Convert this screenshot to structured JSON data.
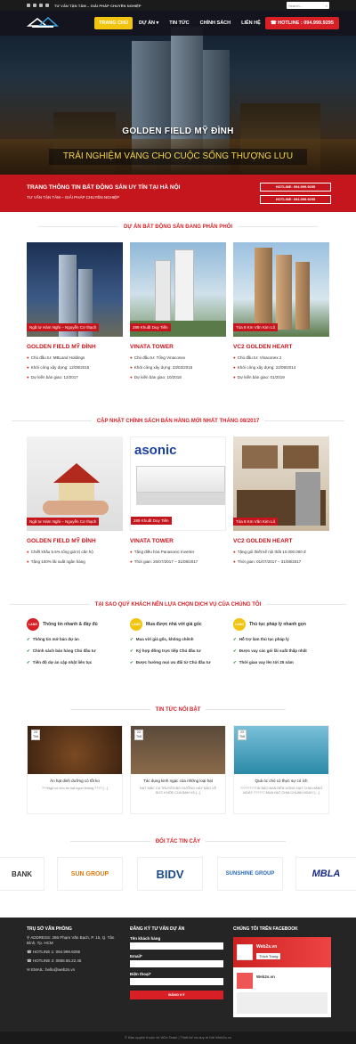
{
  "topbar": {
    "tagline": "TƯ VẤN TẬN TÂM – GIẢI PHÁP CHUYÊN NGHIỆP",
    "search_placeholder": "Search..."
  },
  "nav": {
    "items": [
      "TRANG CHỦ",
      "DỰ ÁN ▾",
      "TIN TỨC",
      "CHÍNH SÁCH",
      "LIÊN HỆ"
    ],
    "hotline": "☎ HOTLINE : 094.999.9295"
  },
  "hero": {
    "title": "GOLDEN FIELD MỸ ĐÌNH",
    "subtitle": "TRẢI NGHIỆM VÀNG CHO CUỘC SỐNG THƯỢNG LƯU"
  },
  "banner": {
    "heading": "TRANG THÔNG TIN BẤT ĐỘNG SẢN UY TÍN TẠI HÀ NỘI",
    "sub": "TƯ VẤN TẬN TÂM – GIẢI PHÁP CHUYÊN NGHIỆP",
    "hotline1": "HOTLINE: 094.999.9295",
    "hotline2": "HOTLINE: 094.999.9295"
  },
  "projects": {
    "title": "DỰ ÁN BẤT ĐỘNG SẢN ĐANG PHÂN PHỐI",
    "cards": [
      {
        "label": "Ngã tư Hàm Nghi – Nguyễn Cơ thạch",
        "name": "GOLDEN FIELD MỸ ĐÌNH",
        "b1": "Chủ đầu tư: MBLand Holdings",
        "b2": "Khởi công xây dựng: 12/08/2015",
        "b3": "Dự kiến bàn giao: 12/2017"
      },
      {
        "label": "289 Khuất Duy Tiến",
        "name": "VINATA TOWER",
        "b1": "Chủ đầu tư: Tổng Vinaconex",
        "b2": "Khởi công xây dựng: 23/03/2015",
        "b3": "Dự kiến bàn giao: 10/2018"
      },
      {
        "label": "Tòa 8 Km Văn Kim Lũ",
        "name": "VC2 GOLDEN HEART",
        "b1": "Chủ đầu tư: Vinaconex 2",
        "b2": "Khởi công xây dựng: 22/09/2014",
        "b3": "Dự kiến bàn giao: 01/2019"
      }
    ]
  },
  "policy": {
    "title": "CẬP NHẬT CHÍNH SÁCH BÁN HÀNG MỚI NHẤT THÁNG 08/2017",
    "cards": [
      {
        "label": "Ngã tư Hàm Nghi – Nguyễn Cơ thạch",
        "name": "GOLDEN FIELD MỸ ĐÌNH",
        "b1": "Chiết khấu 5.5% tổng giá trị căn hộ",
        "b2": "Tặng 100% lãi suất ngân hàng"
      },
      {
        "label": "289 Khuất Duy Tiến",
        "name": "VINATA TOWER",
        "b1": "Tặng điều hòa Panasonic Inverter",
        "b2": "Thời gian: 20/07/2017 – 31/08/2017"
      },
      {
        "label": "Tòa 8 Km Văn Kim Lũ",
        "name": "VC2 GOLDEN HEART",
        "b1": "Tặng gói thiết kế nội thất 10.000.000 đ",
        "b2": "Thời gian: 01/07/2017 – 31/08/2017"
      }
    ]
  },
  "why": {
    "title": "TẠI SAO QUÝ KHÁCH NÊN LỰA CHỌN DỊCH VỤ CỦA CHÚNG TÔI",
    "cols": [
      {
        "badge": "LAND",
        "color": "#d91f26",
        "head": "Thông tin nhanh & đầy đủ",
        "items": [
          "Thông tin mở bán dự án",
          "Chính sách bán hàng Chủ đầu tư",
          "Tiến độ dự án cập nhật liên tục"
        ]
      },
      {
        "badge": "LAND",
        "color": "#f1c40f",
        "head": "Mua được nhà với giá gốc",
        "items": [
          "Mua với giá gốc, không chênh",
          "Ký hợp đồng trực tiếp Chủ đầu tư",
          "Được hưởng mọi ưu đãi từ Chủ đầu tư"
        ]
      },
      {
        "badge": "LAND",
        "color": "#f1c40f",
        "head": "Thủ tục pháp lý nhanh gọn",
        "items": [
          "Hỗ trợ làm thủ tục pháp lý",
          "Được vay các gói lãi suất thấp nhất",
          "Thời gian vay lên tới 25 năm"
        ]
      }
    ]
  },
  "news": {
    "title": "TIN TỨC NỔI BẬT",
    "items": [
      {
        "day": "23",
        "mon": "Th8",
        "title": "Ăn hạt dinh dưỡng có tốt ko",
        "excerpt": "???Ngủ có cho ăn hạt ngon không ???? [...]"
      },
      {
        "day": "23",
        "mon": "Th8",
        "title": "Tác dụng kinh ngạc của những loại hạt",
        "excerpt": "HẠT MẮC CA TRUYỀN BỔ DƯỠNG HẢY BẢO VỆ SỨC KHỎE CỦA BẠN VÀ [...]"
      },
      {
        "day": "23",
        "mon": "Th8",
        "title": "Quà óc chó có thực sự có ích",
        "excerpt": "????????TÁI BẢO BAN NÊN UỐNG HẠT CHIA HẰNG NGÀY ?????? MUA HẠT CHIA CHUẨN NGAY! [...]"
      }
    ]
  },
  "partners": {
    "title": "ĐỐI TÁC TIN CẬY",
    "logos": [
      "BANK",
      "SUN GROUP",
      "BIDV",
      "SUNSHINE GROUP",
      "MBLA"
    ]
  },
  "footer": {
    "office_title": "TRỤ SỞ VĂN PHÒNG",
    "address": "⚲ ADDRESS: 286 Phạm Văn Bạch, P. 15, Q. Tân Bình, Tp. HCM",
    "hotline1": "☎ HOTLINE 1: 094.999.9295",
    "hotline2": "☎ HOTLINE 2: 0858.55.22.45",
    "email": "✉ EMAIL: hello@web2s.vn",
    "form_title": "ĐĂNG KÝ TƯ VẤN DỰ ÁN",
    "f1": "Tên khách hàng",
    "f2": "Email*",
    "f3": "Điện thoại*",
    "submit": "ĐĂNG KÝ",
    "fb_title": "CHÚNG TÔI TRÊN FACEBOOK",
    "fb_name": "Web2s.vn",
    "fb_like": "Thích Trang",
    "copyright": "© Bản quyền thuộc về W2s Team | Thiết kế và duy trì bởi Web2s.vn"
  }
}
